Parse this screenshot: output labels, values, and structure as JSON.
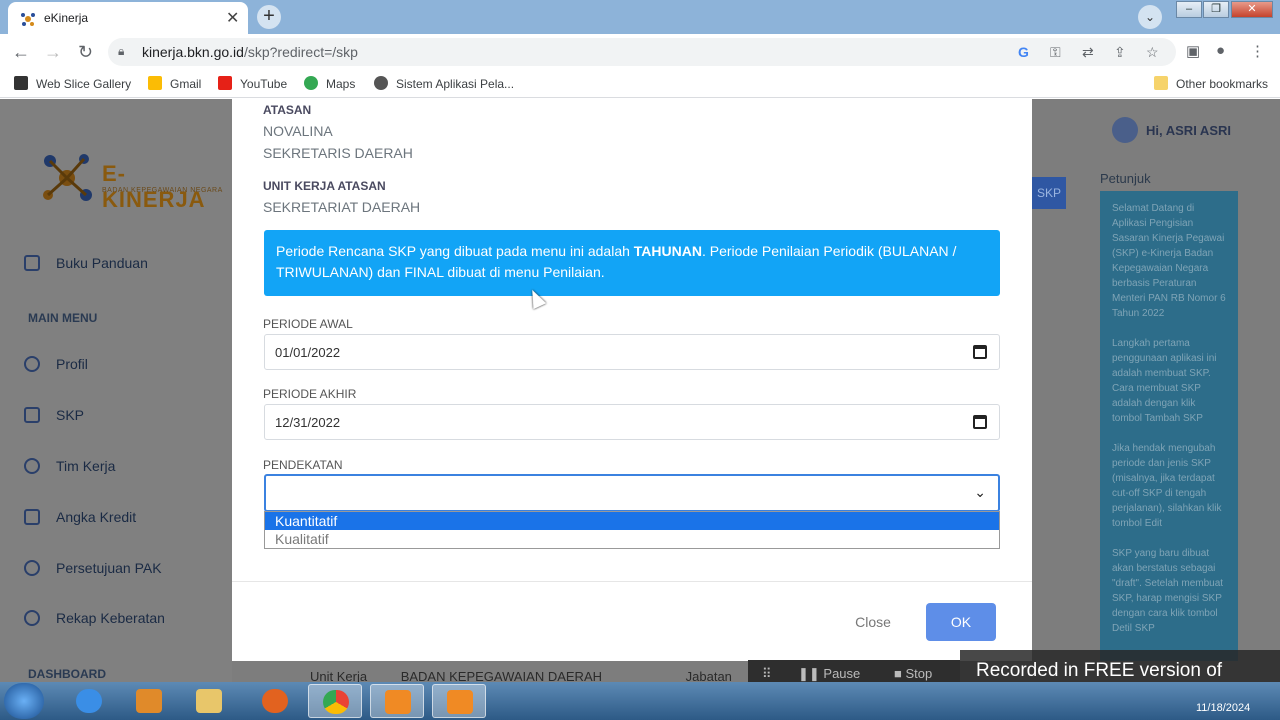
{
  "browser": {
    "tab_title": "eKinerja",
    "url_host": "kinerja.bkn.go.id",
    "url_path": "/skp?redirect=/skp",
    "bookmarks": [
      "Web Slice Gallery",
      "Gmail",
      "YouTube",
      "Maps",
      "Sistem Aplikasi Pela..."
    ],
    "other_bookmarks": "Other bookmarks"
  },
  "app": {
    "logo_text": "E-KINERJA",
    "logo_sub": "BADAN KEPEGAWAIAN NEGARA",
    "sidebar": {
      "buku_panduan": "Buku Panduan",
      "main_menu": "MAIN MENU",
      "items": [
        "Profil",
        "SKP",
        "Tim Kerja",
        "Angka Kredit",
        "Persetujuan PAK",
        "Rekap Keberatan"
      ],
      "dashboard": "DASHBOARD"
    },
    "greeting": "Hi, ASRI ASRI",
    "skp_button": "SKP",
    "petunjuk_title": "Petunjuk",
    "petunjuk_paragraphs": [
      "Selamat Datang di Aplikasi Pengisian Sasaran Kinerja Pegawai (SKP) e-Kinerja Badan Kepegawaian Negara berbasis Peraturan Menteri PAN RB Nomor 6 Tahun 2022",
      "Langkah pertama penggunaan aplikasi ini adalah membuat SKP. Cara membuat SKP adalah dengan klik tombol Tambah SKP",
      "Jika hendak mengubah periode dan jenis SKP (misalnya, jika terdapat cut-off SKP di tengah perjalanan), silahkan klik tombol Edit",
      "SKP yang baru dibuat akan berstatus sebagai \"draft\". Setelah membuat SKP, harap mengisi SKP dengan cara klik tombol Detil SKP"
    ],
    "bg_row": {
      "unit_kerja_label": "Unit Kerja",
      "unit_kerja_value": "BADAN KEPEGAWAIAN DAERAH",
      "jabatan_label": "Jabatan"
    }
  },
  "modal": {
    "atasan_label": "ATASAN",
    "atasan_name": "NOVALINA",
    "atasan_jabatan": "SEKRETARIS DAERAH",
    "unit_kerja_atasan_label": "UNIT KERJA ATASAN",
    "unit_kerja_atasan_value": "SEKRETARIAT DAERAH",
    "info_before": "Periode Rencana SKP yang dibuat pada menu ini adalah ",
    "info_bold": "TAHUNAN",
    "info_after": ". Periode Penilaian Periodik (BULANAN / TRIWULANAN) dan FINAL dibuat di menu Penilaian.",
    "periode_awal_label": "PERIODE AWAL",
    "periode_awal_value": "01/01/2022",
    "periode_akhir_label": "PERIODE AKHIR",
    "periode_akhir_value": "12/31/2022",
    "pendekatan_label": "PENDEKATAN",
    "options": [
      "Kuantitatif",
      "Kualitatif"
    ],
    "close_label": "Close",
    "ok_label": "OK"
  },
  "recorder": {
    "pause": "Pause",
    "stop": "Stop",
    "watermark": "Recorded in FREE version of Icecream Screen Recorder"
  },
  "taskbar": {
    "date": "11/18/2024"
  }
}
